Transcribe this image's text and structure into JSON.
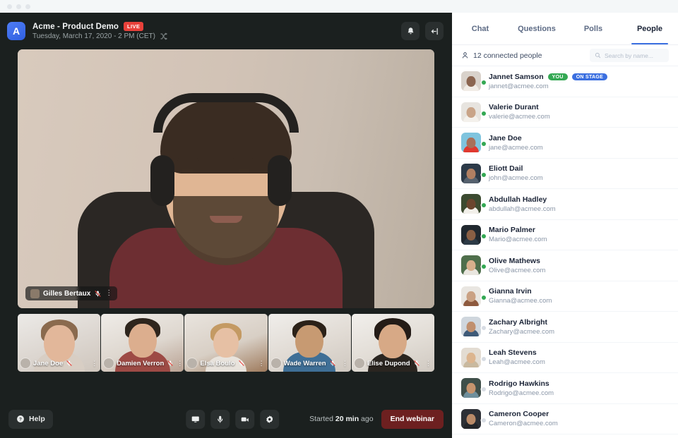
{
  "window": {
    "dots": 3
  },
  "stage": {
    "app_initial": "A",
    "title": "Acme - Product Demo",
    "live_label": "LIVE",
    "subtitle": "Tuesday, March 17, 2020 - 2 PM (CET)",
    "subtitle_icon": "shuffle-icon",
    "header_buttons": [
      {
        "name": "notifications-button",
        "icon": "bell-icon"
      },
      {
        "name": "collapse-panel-button",
        "icon": "arrow-into-bracket-icon"
      }
    ],
    "main_speaker": {
      "name": "Gilles Bertaux",
      "mic": "mic-muted-icon",
      "menu": "kebab-menu-icon"
    },
    "thumbnails": [
      {
        "name": "Jane Doe",
        "mic": "mic-muted-icon"
      },
      {
        "name": "Damien Verron",
        "mic": "mic-muted-icon"
      },
      {
        "name": "Elsa Boulo",
        "mic": "mic-muted-icon"
      },
      {
        "name": "Wade Warren",
        "mic": "mic-muted-icon"
      },
      {
        "name": "Elise Dupond",
        "mic": "mic-muted-icon"
      }
    ],
    "toolbar": {
      "help_label": "Help",
      "help_icon": "question-circle-icon",
      "controls": [
        {
          "name": "screen-share-button",
          "icon": "monitor-icon"
        },
        {
          "name": "microphone-button",
          "icon": "microphone-icon"
        },
        {
          "name": "camera-button",
          "icon": "video-camera-icon"
        },
        {
          "name": "settings-button",
          "icon": "gear-icon"
        }
      ],
      "timer_prefix": "Started ",
      "timer_value": "20 min",
      "timer_suffix": " ago",
      "end_label": "End webinar"
    }
  },
  "panel": {
    "tabs": [
      {
        "label": "Chat",
        "active": false
      },
      {
        "label": "Questions",
        "active": false
      },
      {
        "label": "Polls",
        "active": false
      },
      {
        "label": "People",
        "active": true
      }
    ],
    "count_label": "12 connected people",
    "count_icon": "person-icon",
    "search": {
      "placeholder": "Search by name...",
      "value": "",
      "icon": "search-icon"
    },
    "people": [
      {
        "name": "Jannet Samson",
        "email": "jannet@acmee.com",
        "online": true,
        "badges": [
          {
            "label": "YOU",
            "kind": "you"
          },
          {
            "label": "ON STAGE",
            "kind": "stage"
          }
        ],
        "av": {
          "bg": "#d9d2cb",
          "face": "#8b6550",
          "body": "#f1ece6"
        }
      },
      {
        "name": "Valerie Durant",
        "email": "valerie@acmee.com",
        "online": true,
        "badges": [],
        "av": {
          "bg": "#e7e4df",
          "face": "#c9a488",
          "body": "#f4f1ec"
        }
      },
      {
        "name": "Jane Doe",
        "email": "jane@acmee.com",
        "online": true,
        "badges": [],
        "av": {
          "bg": "#7fc4de",
          "face": "#a8705a",
          "body": "#e0392f"
        }
      },
      {
        "name": "Eliott Dail",
        "email": "john@acmee.com",
        "online": true,
        "badges": [],
        "av": {
          "bg": "#2c3a48",
          "face": "#b07f62",
          "body": "#55616e"
        }
      },
      {
        "name": "Abdullah Hadley",
        "email": "abdullah@acmee.com",
        "online": true,
        "badges": [],
        "av": {
          "bg": "#3c4a30",
          "face": "#6b452e",
          "body": "#f2f0ea"
        }
      },
      {
        "name": "Mario Palmer",
        "email": "Mario@acmee.com",
        "online": true,
        "badges": [],
        "av": {
          "bg": "#20282f",
          "face": "#8a5f44",
          "body": "#2c3a46"
        }
      },
      {
        "name": "Olive Mathews",
        "email": "Olive@acmee.com",
        "online": true,
        "badges": [],
        "av": {
          "bg": "#4f6f4c",
          "face": "#d8b08c",
          "body": "#e9e6df"
        }
      },
      {
        "name": "Gianna Irvin",
        "email": "Gianna@acmee.com",
        "online": true,
        "badges": [],
        "av": {
          "bg": "#e9e6e1",
          "face": "#caa183",
          "body": "#8e5a3e"
        }
      },
      {
        "name": "Zachary Albright",
        "email": "Zachary@acmee.com",
        "online": false,
        "badges": [],
        "av": {
          "bg": "#cfd6dd",
          "face": "#c08f6e",
          "body": "#3e5a78"
        }
      },
      {
        "name": "Leah Stevens",
        "email": "Leah@acmee.com",
        "online": false,
        "badges": [],
        "av": {
          "bg": "#e3dcd2",
          "face": "#dcb58f",
          "body": "#c9b99f"
        }
      },
      {
        "name": "Rodrigo Hawkins",
        "email": "Rodrigo@acmee.com",
        "online": false,
        "badges": [],
        "av": {
          "bg": "#3f4f4a",
          "face": "#c6946e",
          "body": "#6f8f9c"
        }
      },
      {
        "name": "Cameron Cooper",
        "email": "Cameron@acmee.com",
        "online": false,
        "badges": [],
        "av": {
          "bg": "#2d3036",
          "face": "#b98a68",
          "body": "#23252a"
        }
      }
    ]
  }
}
